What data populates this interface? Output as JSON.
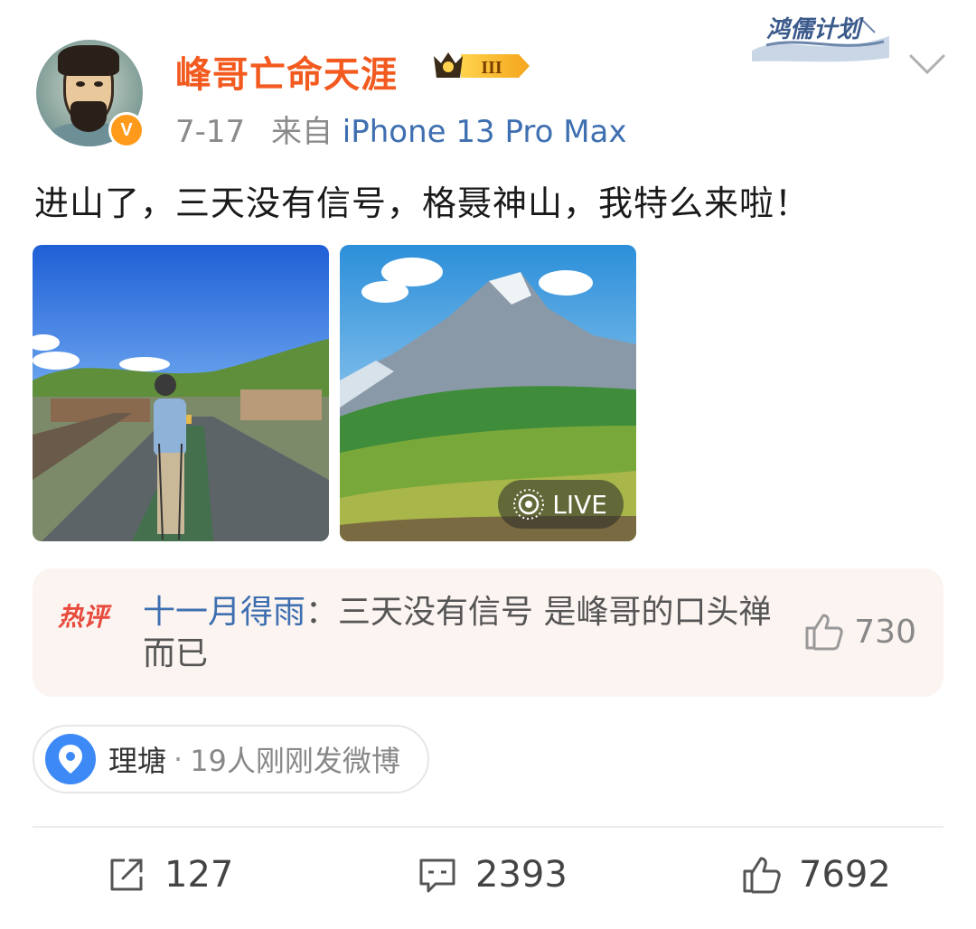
{
  "post": {
    "author": {
      "name": "峰哥亡命天涯",
      "verified_badge": "V",
      "member_badge_level": "III",
      "avatar_icon": "avatar-icon"
    },
    "campaign_badge": "鸿儒计划",
    "meta": {
      "date": "7-17",
      "source_prefix": "来自",
      "device": "iPhone 13 Pro Max"
    },
    "text": "进山了，三天没有信号，格聂神山，我特么来啦！",
    "photos": [
      {
        "description_icon": "photo-hiker-road",
        "live": false
      },
      {
        "description_icon": "photo-mountain-meadow",
        "live": true,
        "live_label": "LIVE"
      }
    ],
    "hot_comment": {
      "tag": "热评",
      "commenter": "十一月得雨",
      "separator": "：",
      "content": "三天没有信号 是峰哥的口头禅而已",
      "likes": "730"
    },
    "location": {
      "city": "理塘",
      "dot": "·",
      "count_text": "19人刚刚发微博"
    },
    "actions": {
      "reposts": "127",
      "comments": "2393",
      "likes": "7692"
    }
  },
  "colors": {
    "username": "#f25a1f",
    "link": "#3e6fb0",
    "hot_tag": "#e84a3c",
    "location_pin": "#3d8af7"
  }
}
